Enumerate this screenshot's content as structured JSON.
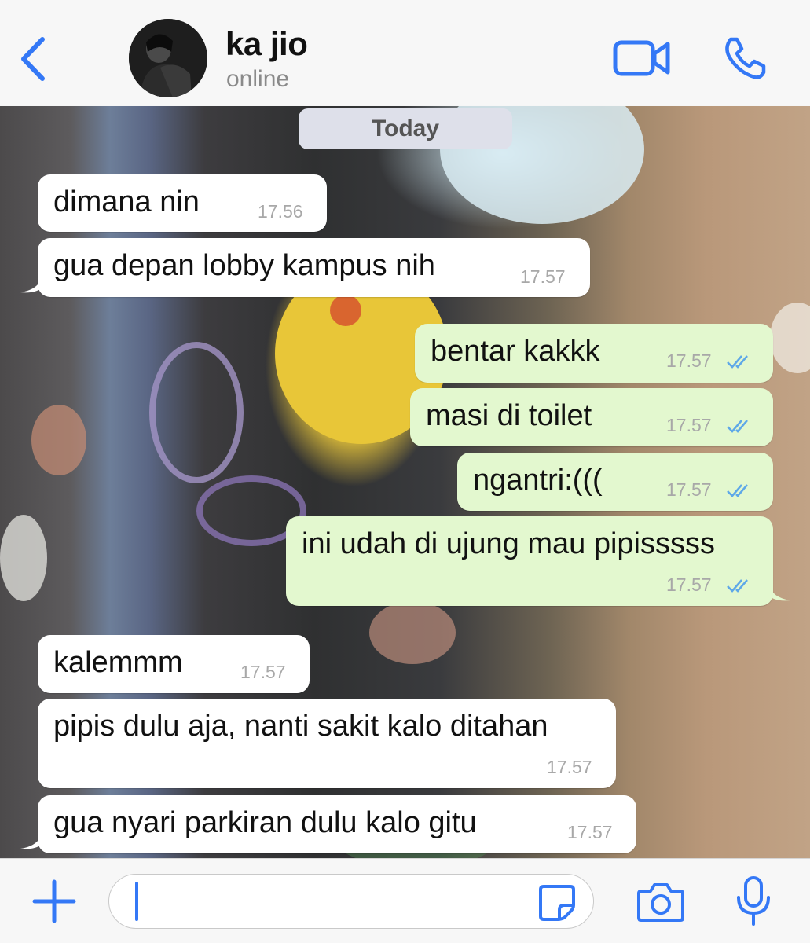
{
  "header": {
    "contact_name": "ka jio",
    "contact_status": "online",
    "icons": [
      "chevron-left-icon",
      "avatar",
      "video-camera-icon",
      "phone-icon"
    ]
  },
  "chat": {
    "date_label": "Today",
    "messages": [
      {
        "direction": "incoming",
        "text": "dimana nin",
        "time": "17.56"
      },
      {
        "direction": "incoming",
        "text": "gua depan lobby kampus nih",
        "time": "17.57"
      },
      {
        "direction": "outgoing",
        "text": "bentar kakkk",
        "time": "17.57",
        "status": "read"
      },
      {
        "direction": "outgoing",
        "text": "masi di toilet",
        "time": "17.57",
        "status": "read"
      },
      {
        "direction": "outgoing",
        "text": "ngantri:(((",
        "time": "17.57",
        "status": "read"
      },
      {
        "direction": "outgoing",
        "text": "ini udah di ujung mau pipisssss",
        "time": "17.57",
        "status": "read"
      },
      {
        "direction": "incoming",
        "text": "kalemmm",
        "time": "17.57"
      },
      {
        "direction": "incoming",
        "text": "pipis dulu aja, nanti sakit kalo ditahan",
        "time": "17.57"
      },
      {
        "direction": "incoming",
        "text": "gua nyari parkiran dulu kalo gitu",
        "time": "17.57"
      }
    ]
  },
  "composer": {
    "value": "",
    "icons": [
      "plus-icon",
      "sticker-icon",
      "camera-icon",
      "microphone-icon"
    ]
  },
  "colors": {
    "accent": "#3478f6",
    "incoming_bubble": "#ffffff",
    "outgoing_bubble": "#e3f8cf",
    "read_ticks": "#5ea8e8"
  }
}
